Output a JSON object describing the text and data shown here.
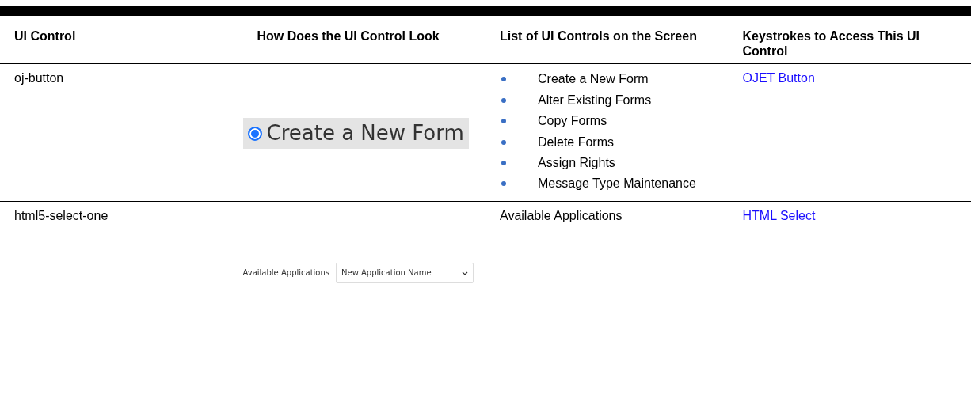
{
  "table": {
    "columns": [
      "UI Control",
      "How Does the UI Control Look",
      "List of UI Controls on the Screen",
      "Keystrokes to Access This UI Control"
    ],
    "rows": [
      {
        "ui_control": "oj-button",
        "look": {
          "kind": "radio",
          "label": "Create a New Form",
          "selected": true
        },
        "screen_controls": {
          "kind": "list",
          "items": [
            "Create a New Form",
            "Alter Existing Forms",
            "Copy Forms",
            "Delete Forms",
            "Assign Rights",
            "Message Type Maintenance"
          ]
        },
        "keystrokes_link": "OJET Button"
      },
      {
        "ui_control": "html5-select-one",
        "look": {
          "kind": "select",
          "label": "Available Applications",
          "value": "New Application Name"
        },
        "screen_controls": {
          "kind": "text",
          "text": "Available Applications"
        },
        "keystrokes_link": "HTML Select"
      }
    ]
  }
}
